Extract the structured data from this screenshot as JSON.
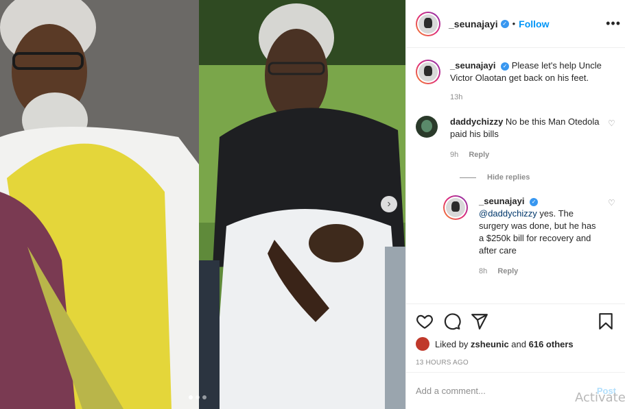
{
  "post": {
    "username": "_seunajayi",
    "follow_label": "Follow",
    "separator": "•",
    "more_icon": "more-horizontal-icon",
    "caption": "Please let's help Uncle Victor Olaotan get back on his feet.",
    "caption_time": "13h"
  },
  "comments": [
    {
      "username": "daddychizzy",
      "text": "No be this Man Otedola paid his bills",
      "time": "9h",
      "reply_label": "Reply",
      "hide_replies_label": "Hide replies",
      "replies": [
        {
          "username": "_seunajayi",
          "mention": "@daddychizzy",
          "text": "yes. The surgery was done, but he has a $250k bill for recovery and after care",
          "time": "8h",
          "reply_label": "Reply"
        }
      ]
    }
  ],
  "actions": {
    "liked_by_prefix": "Liked by",
    "liked_by_user": "zsheunic",
    "liked_by_and": "and",
    "liked_by_others": "616 others",
    "posted_ago": "13 HOURS AGO"
  },
  "composer": {
    "placeholder": "Add a comment...",
    "post_label": "Post"
  },
  "watermark": "Activate",
  "colors": {
    "accent": "#0095f6",
    "verified": "#3897f0",
    "muted": "#8e8e8e"
  }
}
